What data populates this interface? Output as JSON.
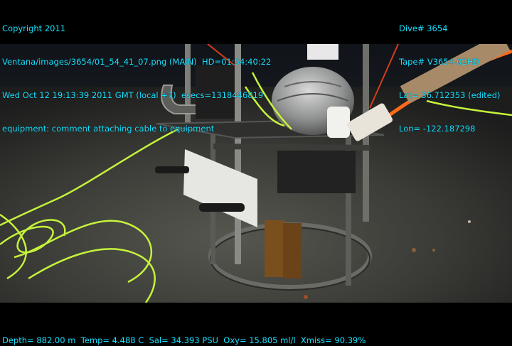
{
  "overlay": {
    "top_left": [
      "Copyright 2011",
      "Ventana/images/3654/01_54_41_07.png (MAIN)  HD=01:54:40:22",
      "Wed Oct 12 19:13:39 2011 GMT (local +7)  esecs=1318446819",
      "equipment: comment attaching cable to equipment"
    ],
    "top_right": [
      "Dive# 3654",
      "Tape# V3654-02HD",
      "Lat= 36.712353 (edited)",
      "Lon= -122.187298"
    ],
    "bottom": "Depth= 882.00 m  Temp= 4.488 C  Sal= 34.393 PSU  Oxy= 15.805 ml/l  Xmiss= 90.39%"
  },
  "colors": {
    "overlay_text": "#19e0ff",
    "background": "#000000",
    "seafloor": "#3a3c38",
    "cable": "#c6f23c",
    "rope": "#ff6a1a"
  }
}
